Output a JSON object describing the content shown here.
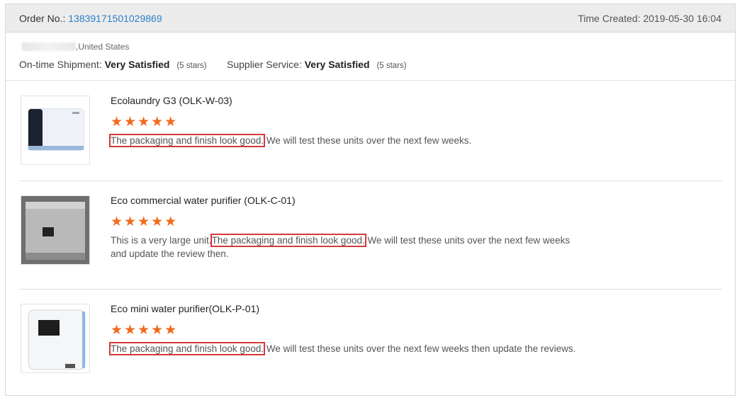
{
  "header": {
    "order_label": "Order No.:",
    "order_number": "13839171501029869",
    "time_label": "Time Created:",
    "time_value": "2019-05-30 16:04"
  },
  "buyer": {
    "country": ",United States"
  },
  "ratings": {
    "shipment_label": "On-time Shipment:",
    "shipment_value": "Very Satisfied",
    "shipment_stars": "(5 stars)",
    "service_label": "Supplier Service:",
    "service_value": "Very Satisfied",
    "service_stars": "(5 stars)"
  },
  "items": [
    {
      "title": "Ecolaundry G3 (OLK-W-03)",
      "stars": "★★★★★",
      "rating": 5,
      "review_prefix": "",
      "review_highlight": "The packaging and finish look good.",
      "review_suffix": " We will test these units over the next few weeks."
    },
    {
      "title": "Eco commercial water purifier (OLK-C-01)",
      "stars": "★★★★★",
      "rating": 5,
      "review_prefix": "This is a very large unit.",
      "review_highlight": "The packaging and finish look good.",
      "review_suffix": " We will test these units over the next few weeks and update the review then."
    },
    {
      "title": "Eco mini water purifier(OLK-P-01)",
      "stars": "★★★★★",
      "rating": 5,
      "review_prefix": "",
      "review_highlight": "The packaging and finish look good.",
      "review_suffix": " We will test these units over the next few weeks then update the reviews."
    }
  ],
  "colors": {
    "link": "#2a7fc7",
    "star": "#f06a1d",
    "highlight_border": "#d6383a",
    "header_bg": "#ececec"
  }
}
